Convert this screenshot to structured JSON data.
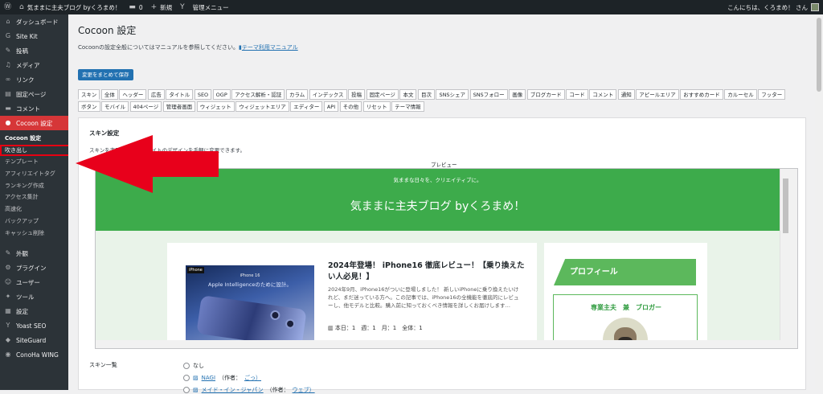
{
  "adminbar": {
    "wp_logo": "wordpress-icon",
    "site_name": "気ままに主夫ブログ byくろまめ！",
    "comments_count": "0",
    "new_label": "新規",
    "admin_menu_label": "管理メニュー",
    "greeting": "こんにちは、くろまめ！ さん"
  },
  "sidebar": {
    "top_items": [
      {
        "icon": "dashboard-icon",
        "glyph": "⌂",
        "label": "ダッシュボード"
      },
      {
        "icon": "sitekit-icon",
        "glyph": "G",
        "label": "Site Kit"
      },
      {
        "icon": "pin-icon",
        "glyph": "✎",
        "label": "投稿"
      },
      {
        "icon": "media-icon",
        "glyph": "♫",
        "label": "メディア"
      },
      {
        "icon": "link-icon",
        "glyph": "∞",
        "label": "リンク"
      },
      {
        "icon": "page-icon",
        "glyph": "▤",
        "label": "固定ページ"
      },
      {
        "icon": "comment-icon",
        "glyph": "▬",
        "label": "コメント"
      }
    ],
    "current": {
      "icon": "cocoon-icon",
      "glyph": "●",
      "label": "Cocoon 設定"
    },
    "submenu": [
      "Cocoon 設定",
      "吹き出し",
      "テンプレート",
      "アフィリエイトタグ",
      "ランキング作成",
      "アクセス集計",
      "高速化",
      "バックアップ",
      "キャッシュ削除"
    ],
    "bottom_items": [
      {
        "icon": "appearance-icon",
        "glyph": "✎",
        "label": "外観"
      },
      {
        "icon": "plugin-icon",
        "glyph": "⚙",
        "label": "プラグイン"
      },
      {
        "icon": "user-icon",
        "glyph": "☺",
        "label": "ユーザー"
      },
      {
        "icon": "tools-icon",
        "glyph": "✦",
        "label": "ツール"
      },
      {
        "icon": "settings-icon",
        "glyph": "▦",
        "label": "設定"
      },
      {
        "icon": "yoast-icon",
        "glyph": "Y",
        "label": "Yoast SEO"
      },
      {
        "icon": "siteguard-icon",
        "glyph": "◆",
        "label": "SiteGuard"
      },
      {
        "icon": "conoha-icon",
        "glyph": "◉",
        "label": "ConoHa WING"
      }
    ]
  },
  "main": {
    "page_title": "Cocoon 設定",
    "intro_text": "Cocoonの設定全般についてはマニュアルを参照してください。",
    "manual_link": "テーマ利用マニュアル",
    "save_button": "変更をまとめて保存",
    "tabs": [
      "スキン",
      "全体",
      "ヘッダー",
      "広告",
      "タイトル",
      "SEO",
      "OGP",
      "アクセス解析・認証",
      "カラム",
      "インデックス",
      "投稿",
      "固定ページ",
      "本文",
      "目次",
      "SNSシェア",
      "SNSフォロー",
      "画像",
      "ブログカード",
      "コード",
      "コメント",
      "通知",
      "アピールエリア",
      "おすすめカード",
      "カルーセル",
      "フッター",
      "ボタン",
      "モバイル",
      "404ページ",
      "管理者画面",
      "ウィジェット",
      "ウィジェットエリア",
      "エディター",
      "API",
      "その他",
      "リセット",
      "テーマ情報"
    ],
    "skin_heading": "スキン設定",
    "skin_desc": "スキンを変更することでサイトのデザインを手軽に変更できます。",
    "preview_label": "プレビュー",
    "preview": {
      "tagline": "気ままな日々を、クリエイティブに。",
      "site_title": "気ままに主夫ブログ byくろまめ！",
      "thumb_badge": "iPhone",
      "thumb_line1": "iPhone 16",
      "thumb_line2": "Apple Intelligenceのために設計。",
      "post_title": "2024年登場！ iPhone16 徹底レビュー！【乗り換えたい人必見！】",
      "post_excerpt": "2024年9月、iPhone16がついに登場しました！ 新しいiPhoneに乗り換えたいけれど、まだ迷っている方へ。この記事では、iPhone16の全機能を徹底的にレビューし、他モデルと比較。購入前に知っておくべき情報を詳しくお届けします…",
      "post_counts": "本日：1　週：1　月：1　全体：1",
      "profile_heading": "プロフィール",
      "profile_name": "専業主夫　兼　ブロガー"
    },
    "skin_list_heading": "スキン一覧",
    "skin_options": [
      {
        "label": "なし",
        "author": "",
        "author_name": ""
      },
      {
        "label": "NAGI",
        "author": "（作者：",
        "author_name": "ごっ）"
      },
      {
        "label": "メイド・イン・ジャパン",
        "author": "（作者：",
        "author_name": "ウェブ）"
      }
    ]
  }
}
